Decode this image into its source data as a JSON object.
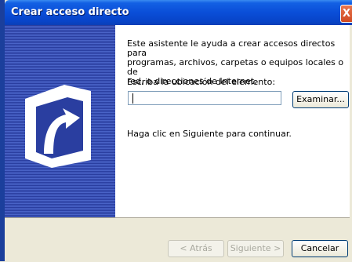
{
  "window": {
    "title": "Crear acceso directo",
    "close_glyph": "X"
  },
  "content": {
    "intro": "Este asistente le ayuda a crear accesos directos para\nprogramas, archivos, carpetas o equipos locales o de\nred, o direcciones de Internet.",
    "location_label": "Escriba la ubicación del elemento:",
    "location_value": "",
    "browse_label": "Examinar...",
    "continue_text": "Haga clic en Siguiente para continuar."
  },
  "footer": {
    "back_label": "< Atrás",
    "next_label": "Siguiente >",
    "cancel_label": "Cancelar"
  },
  "colors": {
    "titlebar": "#0a4ed8",
    "side_panel": "#2a3ea0",
    "face": "#ece9d8"
  },
  "icons": {
    "wizard_graphic": "shortcut-arrow-icon",
    "close": "close-icon"
  }
}
